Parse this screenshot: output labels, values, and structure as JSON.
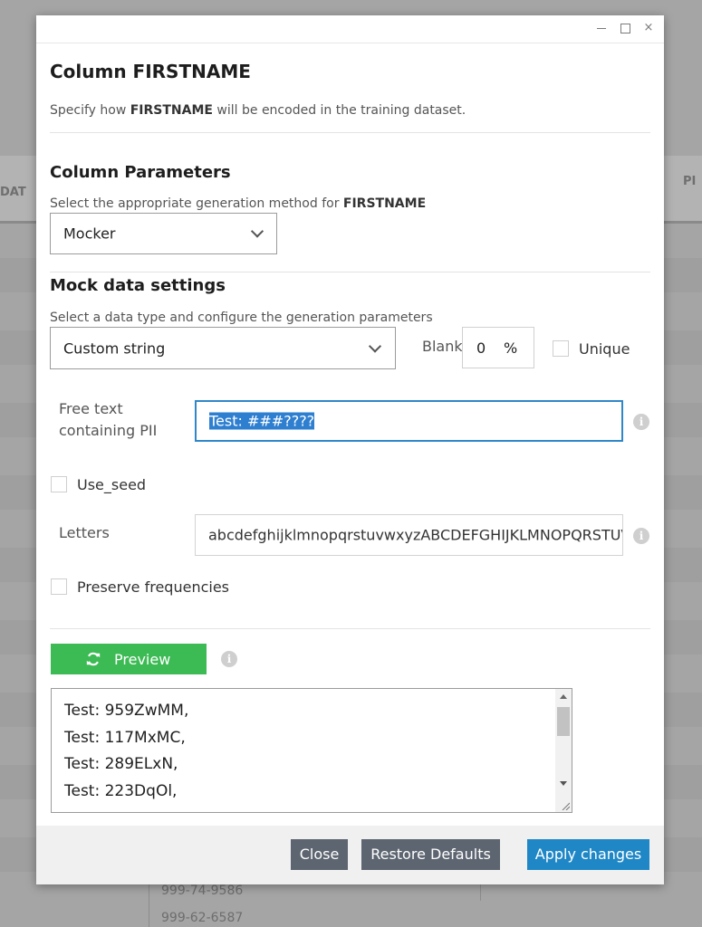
{
  "background": {
    "column_left": "DAT",
    "column_right": "PI",
    "cells": [
      "999-74-9586",
      "999-62-6587"
    ]
  },
  "dialog": {
    "window_controls": {
      "minimize": "minimize",
      "maximize": "maximize",
      "close": "×"
    },
    "title": "Column FIRSTNAME",
    "description": {
      "prefix": "Specify how ",
      "column": "FIRSTNAME",
      "suffix": " will be encoded in the training dataset."
    }
  },
  "column_parameters": {
    "title": "Column Parameters",
    "hint_prefix": "Select the appropriate generation method for ",
    "hint_column": "FIRSTNAME",
    "method_value": "Mocker"
  },
  "mock_settings": {
    "title": "Mock data settings",
    "hint": "Select a data type and configure the generation parameters",
    "data_type_value": "Custom string",
    "blank_label": "Blank",
    "blank_value": "0",
    "blank_unit": "%",
    "unique_label": "Unique",
    "free_text_label_line1": "Free text",
    "free_text_label_line2": "containing PII",
    "free_text_value": "Test: ###????",
    "use_seed_label": "Use_seed",
    "letters_label": "Letters",
    "letters_value": "abcdefghijklmnopqrstuvwxyzABCDEFGHIJKLMNOPQRSTUVWXYZ",
    "preserve_label": "Preserve frequencies"
  },
  "preview": {
    "button_label": "Preview",
    "lines": [
      "Test: 959ZwMM,",
      "Test: 117MxMC,",
      "Test: 289ELxN,",
      "Test: 223DqOl,"
    ]
  },
  "footer": {
    "close_label": "Close",
    "restore_label": "Restore Defaults",
    "apply_label": "Apply changes"
  },
  "colors": {
    "accent_blue": "#1f87c6",
    "preview_green": "#3cba54",
    "secondary_gray": "#5d6570"
  }
}
